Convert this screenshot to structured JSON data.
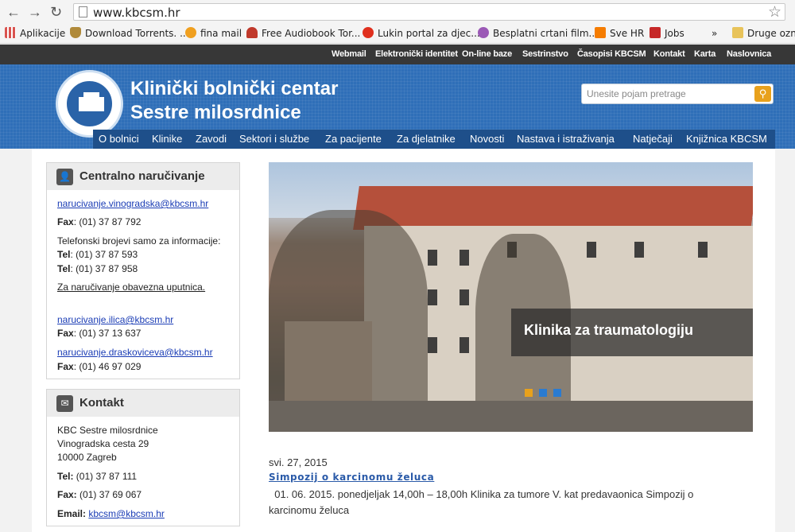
{
  "browser": {
    "url": "www.kbcsm.hr",
    "bookmarks": [
      {
        "label": "Aplikacije",
        "color": "#d9534f"
      },
      {
        "label": "Download Torrents. ...",
        "color": "#b08a3a"
      },
      {
        "label": "fina mail",
        "color": "#f0a020"
      },
      {
        "label": "Free Audiobook Tor...",
        "color": "#c0392b"
      },
      {
        "label": "Lukin portal za djec...",
        "color": "#e0301e"
      },
      {
        "label": "Besplatni crtani film...",
        "color": "#9b59b6"
      },
      {
        "label": "Sve HR",
        "color": "#f57c00"
      },
      {
        "label": "Jobs",
        "color": "#c62828"
      },
      {
        "label": "»",
        "color": ""
      },
      {
        "label": "Druge ozna",
        "color": "#e8c35a"
      }
    ]
  },
  "topnav": [
    "Webmail",
    "Elektronički identitet",
    "On-line baze",
    "Sestrinstvo",
    "Časopisi KBCSM",
    "Kontakt",
    "Karta",
    "Naslovnica"
  ],
  "header": {
    "title_line1": "Klinički bolnički centar",
    "title_line2": "Sestre milosrdnice",
    "search_placeholder": "Unesite pojam pretrage"
  },
  "mainnav": [
    "O bolnici",
    "Klinike",
    "Zavodi",
    "Sektori i službe",
    "Za pacijente",
    "Za djelatnike",
    "Novosti",
    "Nastava i istraživanja",
    "Natječaji",
    "Knjižnica KBCSM"
  ],
  "ordering": {
    "title": "Centralno naručivanje",
    "email1": "narucivanje.vinogradska@kbcsm.hr",
    "fax_label": "Fax",
    "tel_label": "Tel",
    "fax1": ": (01) 37 87 792",
    "info_note": "Telefonski brojevi samo za informacije:",
    "tel1": ": (01) 37 87 593",
    "tel2": ": (01) 37 87 958",
    "referral_note": "Za naručivanje obavezna uputnica.",
    "email2": "narucivanje.ilica@kbcsm.hr",
    "fax2": ": (01) 37 13 637",
    "email3": "narucivanje.draskoviceva@kbcsm.hr",
    "fax3": ": (01) 46 97 029"
  },
  "contact": {
    "title": "Kontakt",
    "name": "KBC Sestre milosrdnice",
    "street": "Vinogradska cesta 29",
    "city": "10000 Zagreb",
    "tel_label": "Tel:",
    "tel": " (01) 37 87 111",
    "fax_label": "Fax:",
    "fax": " (01) 37 69 067",
    "email_label": "Email:",
    "email": "kbcsm@kbcsm.hr"
  },
  "slider": {
    "caption": "Klinika za traumatologiju",
    "dot_colors": [
      "#e8a11c",
      "#2a7bd1",
      "#2a7bd1"
    ]
  },
  "news": {
    "date": "svi. 27, 2015",
    "title": "Simpozij o karcinomu želuca",
    "body": "01. 06. 2015. ponedjeljak 14,00h – 18,00h Klinika za tumore V. kat predavaonica Simpozij o karcinomu želuca"
  }
}
